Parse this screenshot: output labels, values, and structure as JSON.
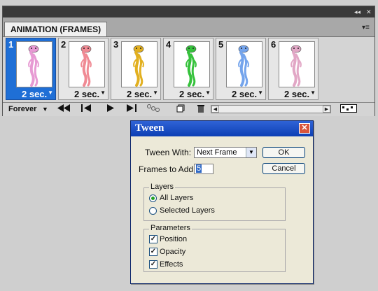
{
  "panel": {
    "tab_label": "ANIMATION (FRAMES)",
    "titlebar_collapse": "◂◂",
    "titlebar_close": "✕",
    "menu_icon": "panel-menu-icon"
  },
  "frames": [
    {
      "number": "1",
      "delay": "2 sec.",
      "figure_color": "#e79ad3",
      "selected": true
    },
    {
      "number": "2",
      "delay": "2 sec.",
      "figure_color": "#f08a94",
      "selected": false
    },
    {
      "number": "3",
      "delay": "2 sec.",
      "figure_color": "#e2b020",
      "selected": false
    },
    {
      "number": "4",
      "delay": "2 sec.",
      "figure_color": "#36c23c",
      "selected": false
    },
    {
      "number": "5",
      "delay": "2 sec.",
      "figure_color": "#74a4ec",
      "selected": false
    },
    {
      "number": "6",
      "delay": "2 sec.",
      "figure_color": "#e2a7c6",
      "selected": false
    }
  ],
  "toolbar": {
    "loop_value": "Forever",
    "icons": [
      "first-frame-icon",
      "previous-frame-icon",
      "play-icon",
      "next-frame-icon",
      "tween-icon",
      "duplicate-frame-icon",
      "delete-frame-icon",
      "convert-timeline-icon"
    ]
  },
  "dialog": {
    "title": "Tween",
    "tween_with_label": "Tween  With:",
    "tween_with_value": "Next  Frame",
    "frames_to_add_label": "Frames to Add:",
    "frames_to_add_value": "5",
    "ok_label": "OK",
    "cancel_label": "Cancel",
    "layers_group_label": "Layers",
    "all_layers_label": "All  Layers",
    "selected_layers_label": "Selected  Layers",
    "parameters_group_label": "Parameters",
    "position_label": "Position",
    "opacity_label": "Opacity",
    "effects_label": "Effects",
    "layers_choice": "All Layers",
    "position_checked": true,
    "opacity_checked": true,
    "effects_checked": true
  },
  "colors": {
    "selected_frame": "#1f6fd6",
    "dialog_title": "#0d3fb4",
    "dialog_bg": "#ece9d8"
  }
}
